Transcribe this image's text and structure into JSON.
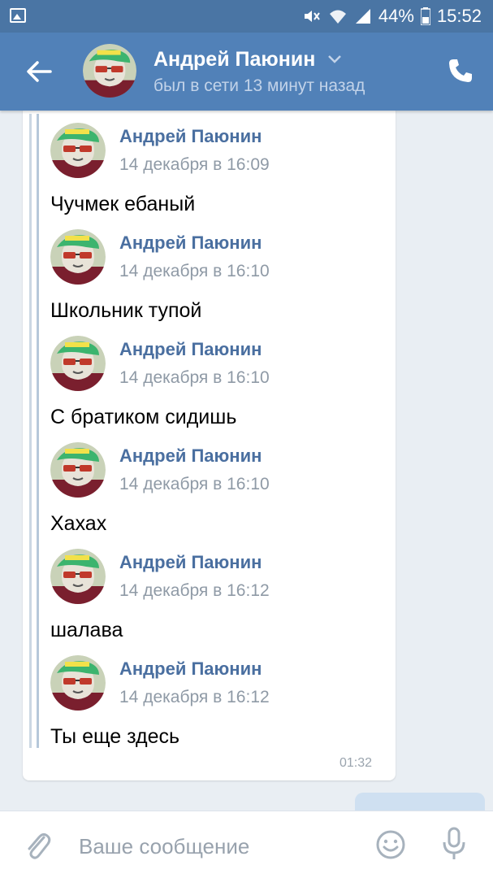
{
  "status_bar": {
    "battery": "44%",
    "time": "15:52"
  },
  "header": {
    "contact_name": "Андрей Паюнин",
    "last_seen": "был в сети 13 минут назад"
  },
  "messages": [
    {
      "author": "Андрей Паюнин",
      "date": "14 декабря в 16:09",
      "text": "Чучмек ебаный"
    },
    {
      "author": "Андрей Паюнин",
      "date": "14 декабря в 16:10",
      "text": "Школьник тупой"
    },
    {
      "author": "Андрей Паюнин",
      "date": "14 декабря в 16:10",
      "text": "С братиком сидишь"
    },
    {
      "author": "Андрей Паюнин",
      "date": "14 декабря в 16:10",
      "text": "Хахах"
    },
    {
      "author": "Андрей Паюнин",
      "date": "14 декабря в 16:12",
      "text": "шалава"
    },
    {
      "author": "Андрей Паюнин",
      "date": "14 декабря в 16:12",
      "text": "Ты еще здесь"
    }
  ],
  "message_time": "01:32",
  "composer": {
    "placeholder": "Ваше сообщение"
  },
  "colors": {
    "header_bg": "#5181b8",
    "status_bg": "#4a75a4",
    "author_name": "#4a6fa0",
    "chat_bg": "#e9eef3"
  },
  "icons": [
    "gallery-icon",
    "mute-icon",
    "wifi-icon",
    "signal-icon",
    "back-arrow-icon",
    "chevron-down-icon",
    "phone-icon",
    "attach-icon",
    "smile-icon",
    "mic-icon"
  ]
}
